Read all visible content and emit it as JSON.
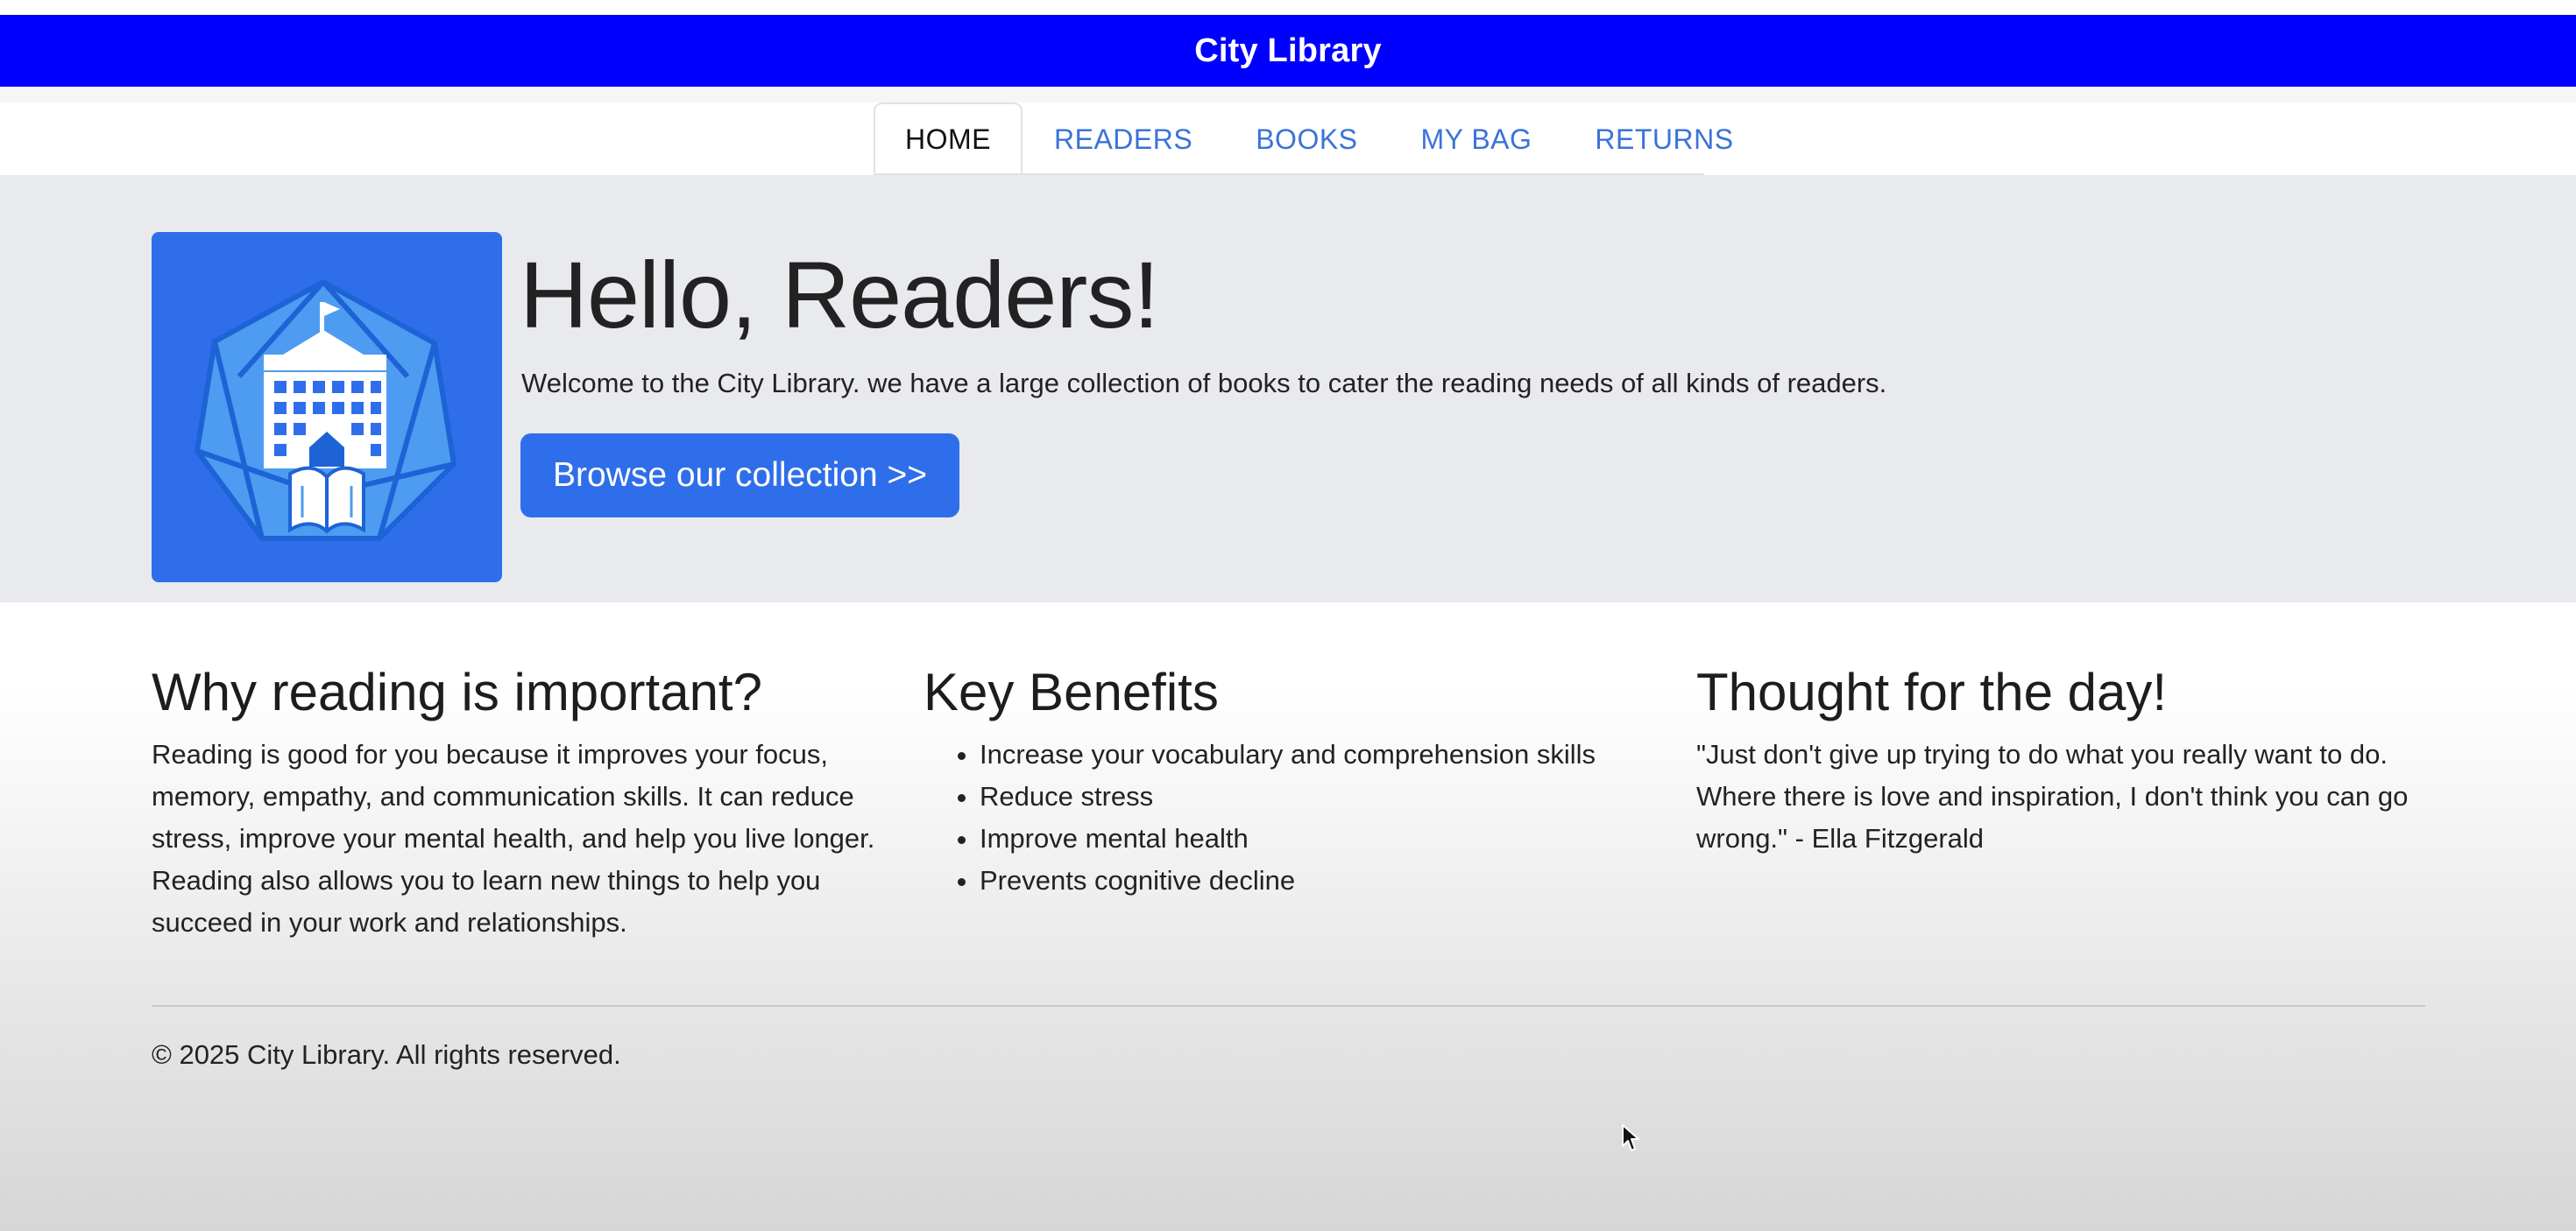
{
  "header": {
    "title": "City Library"
  },
  "nav": {
    "tabs": [
      {
        "label": "HOME",
        "active": true
      },
      {
        "label": "READERS",
        "active": false
      },
      {
        "label": "BOOKS",
        "active": false
      },
      {
        "label": "MY BAG",
        "active": false
      },
      {
        "label": "RETURNS",
        "active": false
      }
    ]
  },
  "hero": {
    "logo_icon": "library-building-logo-icon",
    "title": "Hello, Readers!",
    "subtitle": "Welcome to the City Library. we have a large collection of books to cater the reading needs of all kinds of readers.",
    "button_label": "Browse our collection >>"
  },
  "sections": {
    "why": {
      "heading": "Why reading is important?",
      "body": "Reading is good for you because it improves your focus, memory, empathy, and communication skills. It can reduce stress, improve your mental health, and help you live longer. Reading also allows you to learn new things to help you succeed in your work and relationships."
    },
    "benefits": {
      "heading": "Key Benefits",
      "items": [
        "Increase your vocabulary and comprehension skills",
        "Reduce stress",
        "Improve mental health",
        "Prevents cognitive decline"
      ]
    },
    "thought": {
      "heading": "Thought for the day!",
      "quote": "\"Just don't give up trying to do what you really want to do. Where there is love and inspiration, I don't think you can go wrong.\" - Ella Fitzgerald"
    }
  },
  "footer": {
    "text": "© 2025 City Library. All rights reserved."
  },
  "colors": {
    "title_bar": "#0000ff",
    "accent": "#2f6eea",
    "link": "#3a73d8",
    "hero_bg": "#e9eaee"
  }
}
